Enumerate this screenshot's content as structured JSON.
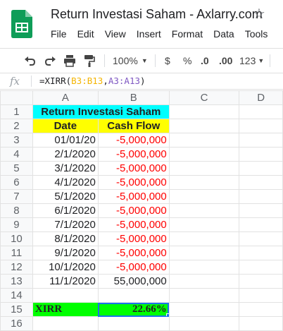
{
  "app": {
    "title": "Return Investasi Saham - Axlarry.com",
    "menu": [
      "File",
      "Edit",
      "View",
      "Insert",
      "Format",
      "Data",
      "Tools"
    ]
  },
  "toolbar": {
    "zoom": "100%",
    "currency": "$",
    "percent": "%",
    "dec_decrease": ".0",
    "dec_increase": ".00",
    "more_formats": "123"
  },
  "formula_bar": {
    "fx": "fx",
    "prefix": "=XIRR(",
    "ref1": "B3:B13",
    "comma": ",",
    "ref2": "A3:A13",
    "suffix": ")"
  },
  "grid": {
    "columns": [
      "A",
      "B",
      "C",
      "D"
    ],
    "rows": [
      "1",
      "2",
      "3",
      "4",
      "5",
      "6",
      "7",
      "8",
      "9",
      "10",
      "11",
      "12",
      "13",
      "14",
      "15",
      "16"
    ],
    "title": "Return Investasi Saham",
    "header": {
      "date": "Date",
      "cashflow": "Cash Flow"
    },
    "data": [
      {
        "date": "01/01/20",
        "cash": "-5,000,000"
      },
      {
        "date": "2/1/2020",
        "cash": "-5,000,000"
      },
      {
        "date": "3/1/2020",
        "cash": "-5,000,000"
      },
      {
        "date": "4/1/2020",
        "cash": "-5,000,000"
      },
      {
        "date": "5/1/2020",
        "cash": "-5,000,000"
      },
      {
        "date": "6/1/2020",
        "cash": "-5,000,000"
      },
      {
        "date": "7/1/2020",
        "cash": "-5,000,000"
      },
      {
        "date": "8/1/2020",
        "cash": "-5,000,000"
      },
      {
        "date": "9/1/2020",
        "cash": "-5,000,000"
      },
      {
        "date": "10/1/2020",
        "cash": "-5,000,000"
      },
      {
        "date": "11/1/2020",
        "cash": "55,000,000"
      }
    ],
    "xirr_label": "XIRR",
    "xirr_value": "22.66%"
  },
  "colors": {
    "title_bg": "#00ffff",
    "header_bg": "#ffff00",
    "xirr_bg": "#00ff00",
    "negative": "#ff0000",
    "selection": "#1a73e8",
    "logo_green": "#0f9d58"
  }
}
